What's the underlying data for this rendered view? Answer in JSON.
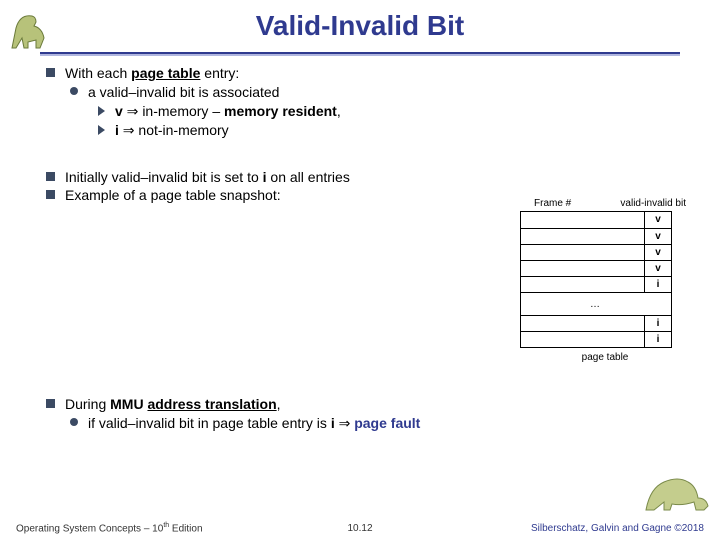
{
  "title": "Valid-Invalid Bit",
  "bullets": {
    "l0_a": "With each ",
    "l0_a_kw": "page table",
    "l0_a_tail": " entry:",
    "l1_a": "a valid–invalid bit is associated",
    "l2_a_lead": "v",
    "l2_a_arrow": " ⇒ ",
    "l2_a_mid": "in-memory – ",
    "l2_a_kw": "memory resident",
    "l2_a_tail": ",",
    "l2_b_lead": "i",
    "l2_b_arrow": "  ⇒ ",
    "l2_b_tail": "not-in-memory",
    "l0_b_a": "Initially valid–invalid bit is set to ",
    "l0_b_i": "i",
    "l0_b_b": " on all entries",
    "l0_c": "Example of a page table snapshot:",
    "l0_d_a": "During ",
    "l0_d_kw1": "MMU",
    "l0_d_mid": " ",
    "l0_d_kw2": "address translation",
    "l0_d_tail": ",",
    "l1_d_a": "if valid–invalid bit in page table entry is ",
    "l1_d_i": "i",
    "l1_d_arrow": " ⇒ ",
    "l1_d_kw": "page fault"
  },
  "page_table": {
    "header_frame": "Frame #",
    "header_bit": "valid-invalid bit",
    "bits_top": [
      "v",
      "v",
      "v",
      "v",
      "i"
    ],
    "dots": "…",
    "bits_bottom": [
      "i",
      "i"
    ],
    "caption": "page table"
  },
  "chart_data": {
    "type": "table",
    "title": "page table snapshot",
    "columns": [
      "Frame #",
      "valid-invalid bit"
    ],
    "rows": [
      [
        "",
        "v"
      ],
      [
        "",
        "v"
      ],
      [
        "",
        "v"
      ],
      [
        "",
        "v"
      ],
      [
        "",
        "i"
      ],
      [
        "…",
        ""
      ],
      [
        "",
        "i"
      ],
      [
        "",
        "i"
      ]
    ]
  },
  "footer": {
    "left_a": "Operating System Concepts – 10",
    "left_sup": "th",
    "left_b": " Edition",
    "center": "10.12",
    "right": "Silberschatz, Galvin and Gagne ©2018"
  }
}
